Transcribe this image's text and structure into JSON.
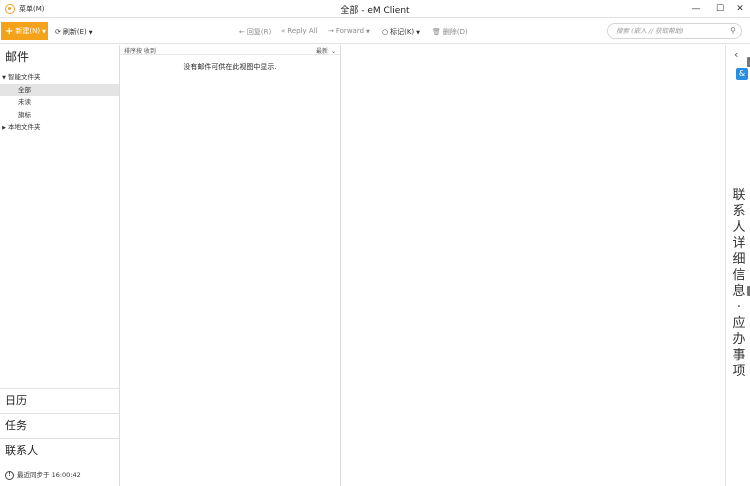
{
  "window": {
    "menu_label": "菜单(M)",
    "title": "全部 - eM Client",
    "controls": [
      "—",
      "☐",
      "✕"
    ]
  },
  "toolbar": {
    "new_label": "新建(N)",
    "refresh_label": "刷新(E)",
    "reply_label": "回复(R)",
    "reply_all_label": "Reply All",
    "forward_label": "Forward",
    "flag_label": "标记(K)",
    "delete_label": "删除(D)",
    "search_placeholder": "搜索 (嵌入 // 获取帮助)"
  },
  "sidebar": {
    "mail_title": "邮件",
    "smart_folders_label": "智能文件夹",
    "smart_items": [
      "全部",
      "未读",
      "旗标"
    ],
    "local_folders_label": "本地文件夹",
    "nav": [
      "日历",
      "任务",
      "联系人"
    ],
    "sync_status": "最近同步于 16:00:42"
  },
  "message_list": {
    "sort_label": "排序按 收到",
    "sort_order": "最新",
    "empty_text": "没有邮件可供在此视图中显示."
  },
  "right_panel": {
    "vertical_text": "联系人详细信息 · 应办事项"
  },
  "colors": {
    "accent": "#f5a21b",
    "badge": "#2a8fe0"
  }
}
